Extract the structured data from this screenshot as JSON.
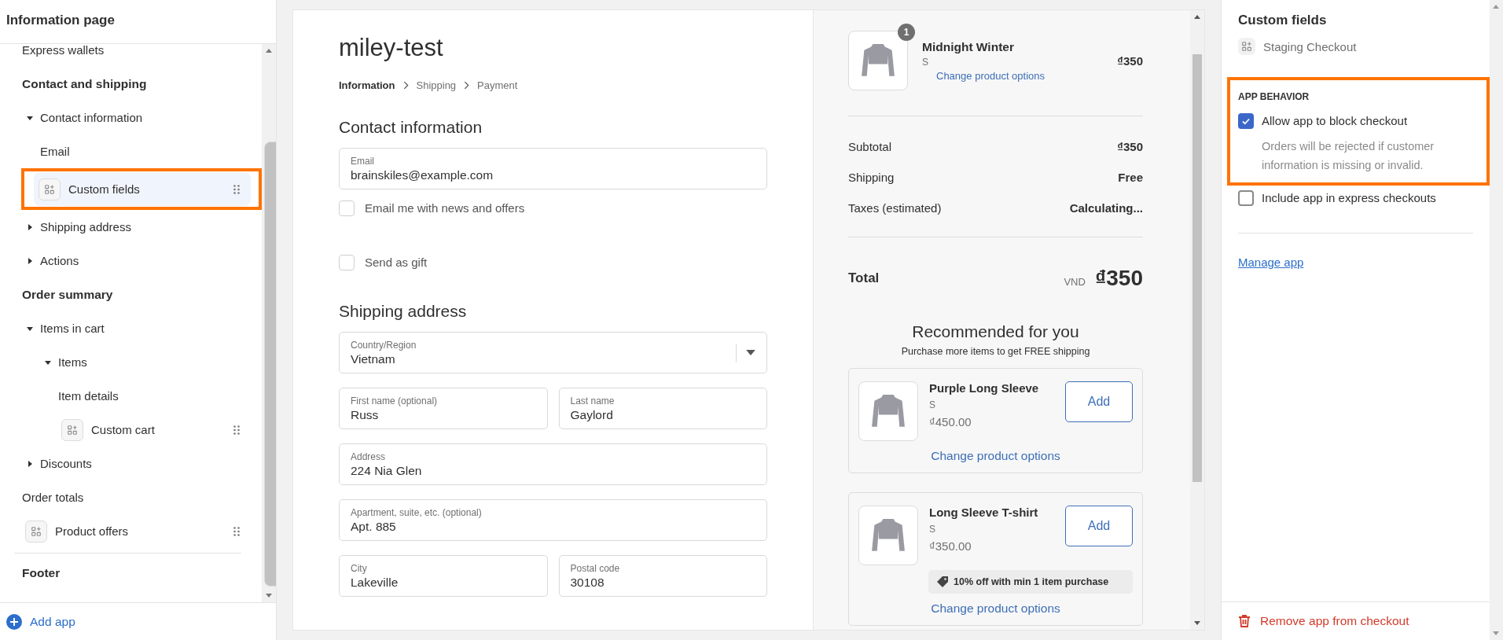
{
  "sidebar": {
    "title": "Information page",
    "items": [
      {
        "kind": "item",
        "label": "Express wallets"
      },
      {
        "kind": "heading",
        "label": "Contact and shipping"
      },
      {
        "kind": "group",
        "label": "Contact information",
        "expanded": true,
        "children": [
          {
            "kind": "item",
            "label": "Email"
          },
          {
            "kind": "app",
            "label": "Custom fields",
            "selected": true,
            "highlighted": true
          }
        ]
      },
      {
        "kind": "group",
        "label": "Shipping address",
        "expanded": false
      },
      {
        "kind": "group",
        "label": "Actions",
        "expanded": false
      },
      {
        "kind": "heading",
        "label": "Order summary"
      },
      {
        "kind": "group",
        "label": "Items in cart",
        "expanded": true,
        "children": [
          {
            "kind": "group",
            "label": "Items",
            "expanded": true,
            "children": [
              {
                "kind": "item",
                "label": "Item details"
              },
              {
                "kind": "app",
                "label": "Custom cart",
                "selected": false,
                "highlighted": false
              }
            ]
          }
        ]
      },
      {
        "kind": "group",
        "label": "Discounts",
        "expanded": false
      },
      {
        "kind": "item",
        "label": "Order totals"
      },
      {
        "kind": "app",
        "label": "Product offers",
        "selected": false,
        "highlighted": false
      },
      {
        "kind": "footer",
        "label": "Footer"
      }
    ],
    "add_app": "Add app"
  },
  "preview": {
    "store_name": "miley-test",
    "breadcrumb": [
      {
        "label": "Information",
        "selected": true
      },
      {
        "label": "Shipping",
        "selected": false
      },
      {
        "label": "Payment",
        "selected": false
      }
    ],
    "contact": {
      "heading": "Contact information",
      "email": {
        "label": "Email",
        "value": "brainskiles@example.com"
      },
      "options": [
        {
          "label": "Email me with news and offers",
          "checked": false
        },
        {
          "label": "Send as gift",
          "checked": false
        }
      ]
    },
    "shipping": {
      "heading": "Shipping address",
      "rows": [
        [
          {
            "kind": "select",
            "label": "Country/Region",
            "value": "Vietnam"
          }
        ],
        [
          {
            "kind": "text",
            "label": "First name (optional)",
            "value": "Russ"
          },
          {
            "kind": "text",
            "label": "Last name",
            "value": "Gaylord"
          }
        ],
        [
          {
            "kind": "text",
            "label": "Address",
            "value": "224 Nia Glen"
          }
        ],
        [
          {
            "kind": "text",
            "label": "Apartment, suite, etc. (optional)",
            "value": "Apt. 885"
          }
        ],
        [
          {
            "kind": "text",
            "label": "City",
            "value": "Lakeville"
          },
          {
            "kind": "text",
            "label": "Postal code",
            "value": "30108"
          }
        ]
      ]
    },
    "summary": {
      "item": {
        "name": "Midnight Winter",
        "variant": "S",
        "link": "Change product options",
        "price": "₫350",
        "quantity": "1"
      },
      "lines": [
        {
          "label": "Subtotal",
          "value": "₫350"
        },
        {
          "label": "Shipping",
          "value": "Free"
        },
        {
          "label": "Taxes (estimated)",
          "value": "Calculating..."
        }
      ],
      "total": {
        "label": "Total",
        "currency": "VND",
        "value": "₫350"
      },
      "recommended": {
        "heading": "Recommended for you",
        "subheading": "Purchase more items to get FREE shipping",
        "products": [
          {
            "name": "Purple Long Sleeve",
            "variant": "S",
            "price": "₫450.00",
            "action": "Add",
            "link": "Change product options"
          },
          {
            "name": "Long Sleeve T-shirt",
            "variant": "S",
            "price": "₫350.00",
            "action": "Add",
            "discount": "10% off with min 1 item purchase",
            "link": "Change product options"
          }
        ]
      }
    }
  },
  "panel": {
    "title": "Custom fields",
    "app_name": "Staging Checkout",
    "sections": [
      {
        "title": "APP BEHAVIOR",
        "highlighted": true,
        "options": [
          {
            "label": "Allow app to block checkout",
            "checked": true,
            "description": "Orders will be rejected if customer information is missing or invalid."
          }
        ]
      },
      {
        "options": [
          {
            "label": "Include app in express checkouts",
            "checked": false
          }
        ]
      }
    ],
    "link": "Manage app",
    "remove": "Remove app from checkout"
  }
}
